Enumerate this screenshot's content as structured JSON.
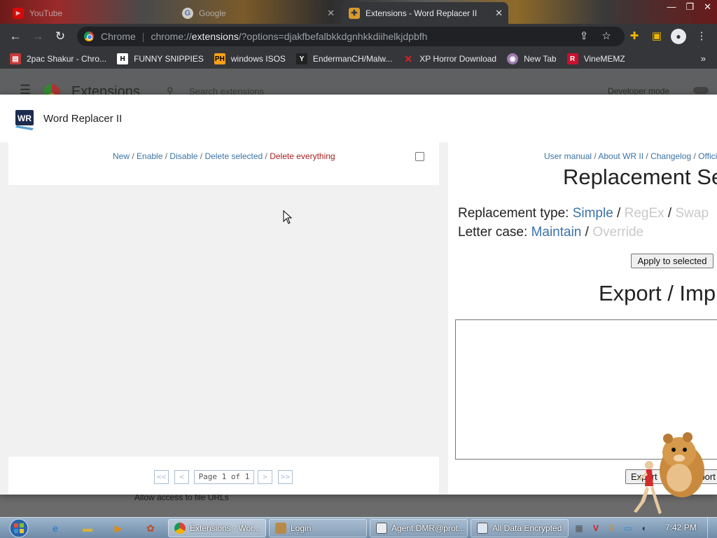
{
  "tabs": [
    {
      "title": "YouTube",
      "icon": "youtube-icon"
    },
    {
      "title": "Google",
      "icon": "google-icon"
    },
    {
      "title": "Extensions - Word Replacer II",
      "icon": "puzzle-icon"
    }
  ],
  "address_bar": {
    "site_label": "Chrome",
    "url_scheme": "chrome://",
    "url_host": "extensions",
    "url_path": "/?options=djakfbefalbkkdgnhkkdiihelkjdpbfh"
  },
  "bookmarks": [
    {
      "label": "2pac Shakur - Chro...",
      "icon": "bookmark-icon"
    },
    {
      "label": "FUNNY SNIPPIES",
      "icon": "h-icon"
    },
    {
      "label": "windows ISOS",
      "icon": "ph-icon"
    },
    {
      "label": "EndermanCH/Malw...",
      "icon": "yp-icon"
    },
    {
      "label": "XP Horror Download",
      "icon": "x-icon"
    },
    {
      "label": "New Tab",
      "icon": "globe-icon"
    },
    {
      "label": "VineMEMZ",
      "icon": "r-icon"
    }
  ],
  "extensions_page": {
    "title": "Extensions",
    "search_placeholder": "Search extensions",
    "developer_mode_label": "Developer mode",
    "file_urls_label": "Allow access to file URLs"
  },
  "modal": {
    "title": "Word Replacer II",
    "logo_text": "WR"
  },
  "left_panel": {
    "actions": {
      "new": "New",
      "enable": "Enable",
      "disable": "Disable",
      "delete_selected": "Delete selected",
      "delete_everything": "Delete everything",
      "separator": " / "
    },
    "pagination": {
      "first": "<<",
      "prev": "<",
      "label": "Page 1 of 1",
      "next": ">",
      "last": ">>"
    }
  },
  "right_panel": {
    "links": [
      "User manual",
      "About WR II",
      "Changelog",
      "Offici"
    ],
    "settings_heading": "Replacement Se",
    "replacement_type": {
      "label": "Replacement type: ",
      "options": [
        "Simple",
        "RegEx",
        "Swap"
      ]
    },
    "letter_case": {
      "label": "Letter case: ",
      "options": [
        "Maintain",
        "Override"
      ]
    },
    "apply_button": "Apply to selected",
    "export_heading": "Export / Imp",
    "textarea_value": "",
    "export_button": "Export",
    "import_button": "Import"
  },
  "taskbar": {
    "tasks": [
      {
        "label": "Extensions - Wor...",
        "icon": "chrome-icon"
      },
      {
        "label": "Login",
        "icon": "app-icon"
      },
      {
        "label": "Agent.DMR@prot...",
        "icon": "mail-icon"
      },
      {
        "label": "All Data Encrypted",
        "icon": "window-icon"
      }
    ],
    "clock": "7:42 PM"
  },
  "colors": {
    "link_blue": "#3b73a8",
    "danger_red": "#a52020",
    "inactive_gray": "#c9c9c9",
    "chrome_dark": "#35363a"
  }
}
